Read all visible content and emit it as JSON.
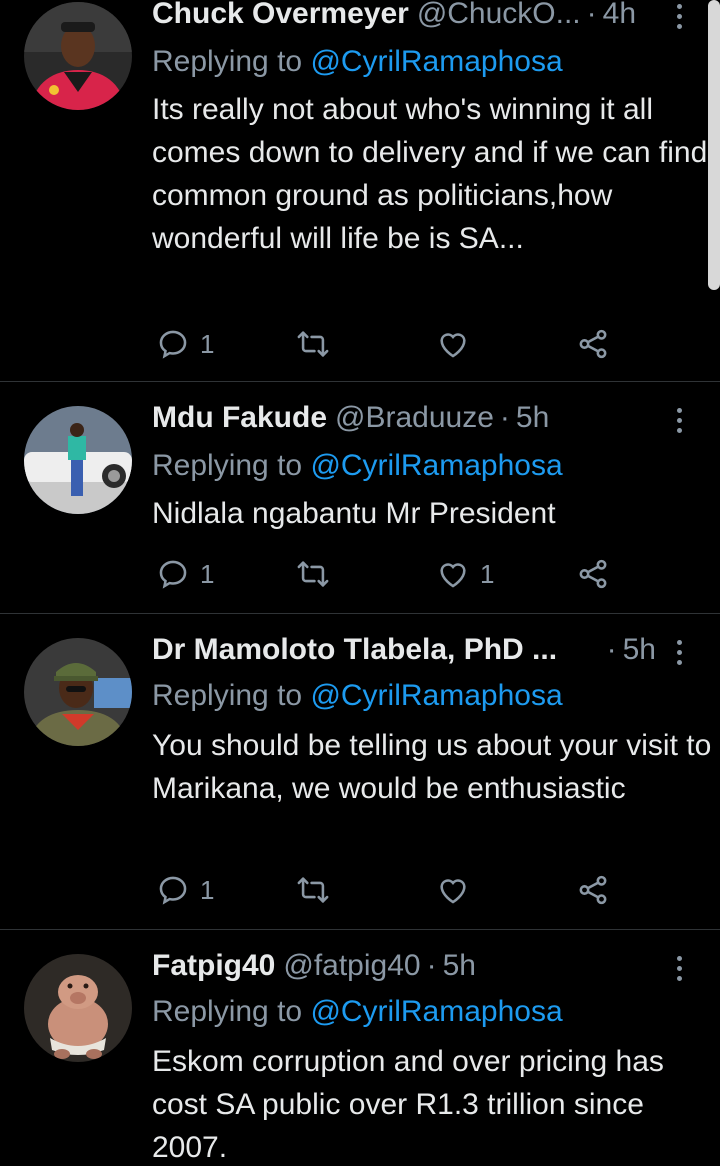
{
  "tweets": [
    {
      "name": "Chuck Overmeyer",
      "handle": "@ChuckO...",
      "time": "4h",
      "reply_prefix": "Replying to",
      "reply_to": "@CyrilRamaphosa",
      "text": "Its really not about who's winning it all comes down to delivery and if we can find common ground as politicians,how wonderful will life be is SA...",
      "reply_count": "1",
      "retweet_count": "",
      "like_count": ""
    },
    {
      "name": "Mdu Fakude",
      "handle": "@Braduuze",
      "time": "5h",
      "reply_prefix": "Replying to",
      "reply_to": "@CyrilRamaphosa",
      "text": "Nidlala ngabantu Mr President",
      "reply_count": "1",
      "retweet_count": "",
      "like_count": "1"
    },
    {
      "name": "Dr Mamoloto Tlabela, PhD ...",
      "handle": "",
      "time": "5h",
      "reply_prefix": "Replying to",
      "reply_to": "@CyrilRamaphosa",
      "text": "You should be telling us about your visit to Marikana, we would be enthusiastic",
      "reply_count": "1",
      "retweet_count": "",
      "like_count": ""
    },
    {
      "name": "Fatpig40",
      "handle": "@fatpig40",
      "time": "5h",
      "reply_prefix": "Replying to",
      "reply_to": "@CyrilRamaphosa",
      "text": "Eskom corruption and over pricing has cost SA public over R1.3 trillion since 2007.",
      "reply_count": "",
      "retweet_count": "",
      "like_count": ""
    }
  ],
  "dot_separator": "·",
  "icons": {
    "reply": "speech-bubble-icon",
    "retweet": "retweet-arrows-icon",
    "like": "heart-icon",
    "share": "share-nodes-icon",
    "more": "vertical-dots-icon"
  },
  "colors": {
    "background": "#000000",
    "text": "#e7e9ea",
    "secondary": "#8b98a5",
    "accent": "#1d9bf0",
    "divider": "#2f3336"
  }
}
